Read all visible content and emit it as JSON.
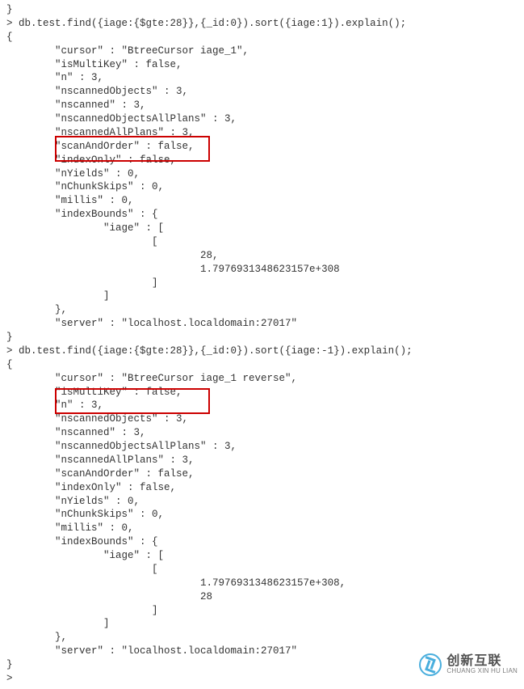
{
  "block1": {
    "prefix": "}",
    "cmd": "> db.test.find({iage:{$gte:28}},{_id:0}).sort({iage:1}).explain();",
    "open": "{",
    "l01": "        \"cursor\" : \"BtreeCursor iage_1\",",
    "l02": "        \"isMultiKey\" : false,",
    "l03": "        \"n\" : 3,",
    "l04": "        \"nscannedObjects\" : 3,",
    "l05": "        \"nscanned\" : 3,",
    "l06": "        \"nscannedObjectsAllPlans\" : 3,",
    "l07": "        \"nscannedAllPlans\" : 3,",
    "l08": "        \"scanAndOrder\" : false,",
    "l09": "        \"indexOnly\" : false,",
    "l10": "        \"nYields\" : 0,",
    "l11": "        \"nChunkSkips\" : 0,",
    "l12": "        \"millis\" : 0,",
    "l13": "        \"indexBounds\" : {",
    "l14": "                \"iage\" : [",
    "l15": "                        [",
    "l16": "                                28,",
    "l17": "                                1.7976931348623157e+308",
    "l18": "                        ]",
    "l19": "                ]",
    "l20": "        },",
    "l21": "        \"server\" : \"localhost.localdomain:27017\"",
    "close": "}"
  },
  "block2": {
    "cmd": "> db.test.find({iage:{$gte:28}},{_id:0}).sort({iage:-1}).explain();",
    "open": "{",
    "l01": "        \"cursor\" : \"BtreeCursor iage_1 reverse\",",
    "l02": "        \"isMultiKey\" : false,",
    "l03": "        \"n\" : 3,",
    "l04": "        \"nscannedObjects\" : 3,",
    "l05": "        \"nscanned\" : 3,",
    "l06": "        \"nscannedObjectsAllPlans\" : 3,",
    "l07": "        \"nscannedAllPlans\" : 3,",
    "l08": "        \"scanAndOrder\" : false,",
    "l09": "        \"indexOnly\" : false,",
    "l10": "        \"nYields\" : 0,",
    "l11": "        \"nChunkSkips\" : 0,",
    "l12": "        \"millis\" : 0,",
    "l13": "        \"indexBounds\" : {",
    "l14": "                \"iage\" : [",
    "l15": "                        [",
    "l16": "                                1.7976931348623157e+308,",
    "l17": "                                28",
    "l18": "                        ]",
    "l19": "                ]",
    "l20": "        },",
    "l21": "        \"server\" : \"localhost.localdomain:27017\"",
    "close": "}",
    "prompt": ">"
  },
  "watermark": {
    "cn": "创新互联",
    "en": "CHUANG XIN HU LIAN"
  }
}
